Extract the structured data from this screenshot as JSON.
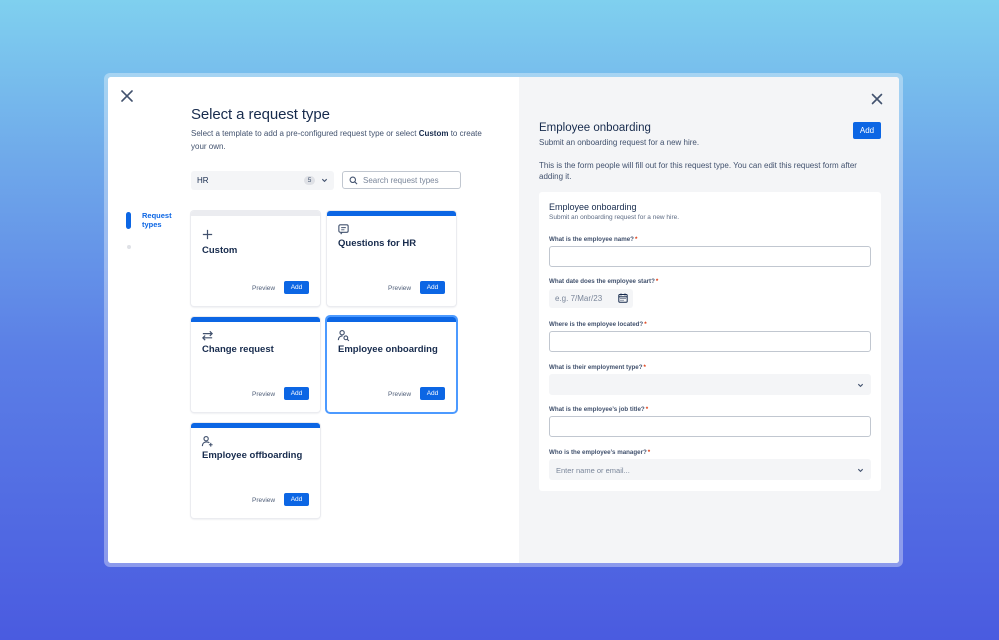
{
  "left": {
    "title": "Select a request type",
    "description_pre": "Select a template to add a pre-configured request type or select ",
    "description_bold": "Custom",
    "description_post": " to create your own.",
    "filter": {
      "value": "HR",
      "count": "5"
    },
    "search": {
      "placeholder": "Search request types"
    },
    "nav": {
      "active_label": "Request types"
    },
    "cards": [
      {
        "name": "Custom",
        "icon": "plus-icon",
        "preview": "Preview",
        "add": "Add"
      },
      {
        "name": "Questions for HR",
        "icon": "message-icon",
        "preview": "Preview",
        "add": "Add"
      },
      {
        "name": "Change request",
        "icon": "swap-arrows-icon",
        "preview": "Preview",
        "add": "Add"
      },
      {
        "name": "Employee onboarding",
        "icon": "person-search-icon",
        "preview": "Preview",
        "add": "Add",
        "selected": true
      },
      {
        "name": "Employee offboarding",
        "icon": "person-add-icon",
        "preview": "Preview",
        "add": "Add"
      }
    ]
  },
  "right": {
    "title": "Employee onboarding",
    "subtitle": "Submit an onboarding request for a new hire.",
    "add_label": "Add",
    "description": "This is the form people will fill out for this request type. You can edit this request form after adding it.",
    "form": {
      "title": "Employee onboarding",
      "subtitle": "Submit an onboarding request for a new hire.",
      "questions": [
        {
          "label": "What is the employee name?",
          "required": "*",
          "type": "text"
        },
        {
          "label": "What date does the employee start?",
          "required": "*",
          "type": "date",
          "placeholder": "e.g. 7/Mar/23"
        },
        {
          "label": "Where is the employee located?",
          "required": "*",
          "type": "text"
        },
        {
          "label": "What is their employment type?",
          "required": "*",
          "type": "select"
        },
        {
          "label": "What is the employee’s job title?",
          "required": "*",
          "type": "text"
        },
        {
          "label": "Who is the employee’s manager?",
          "required": "*",
          "type": "user-picker",
          "placeholder": "Enter name or email..."
        }
      ]
    }
  },
  "colors": {
    "primary": "#0c66e4",
    "text": "#172b4d",
    "subtle": "#42526e",
    "panel": "#f4f5f7"
  }
}
